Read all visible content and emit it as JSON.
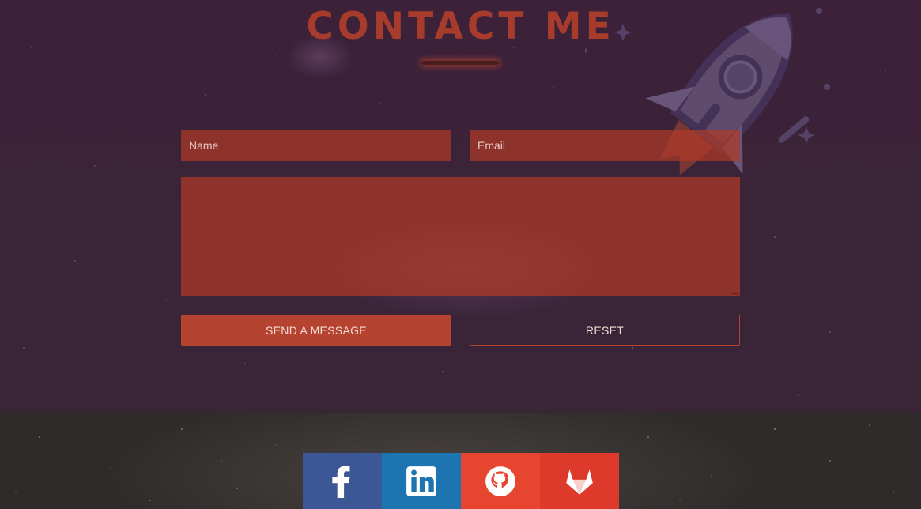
{
  "contact": {
    "title": "CONTACT ME",
    "name_placeholder": "Name",
    "email_placeholder": "Email",
    "message_value": "",
    "send_label": "SEND A MESSAGE",
    "reset_label": "RESET"
  },
  "social": [
    {
      "icon": "facebook-icon",
      "color": "#3b5795"
    },
    {
      "icon": "linkedin-icon",
      "color": "#1d74b0"
    },
    {
      "icon": "github-icon",
      "color": "#e6462f"
    },
    {
      "icon": "gitlab-icon",
      "color": "#dd3a2b"
    }
  ],
  "colors": {
    "accent": "#b5432f",
    "title": "#a83c2c",
    "background": "#3b2238"
  }
}
